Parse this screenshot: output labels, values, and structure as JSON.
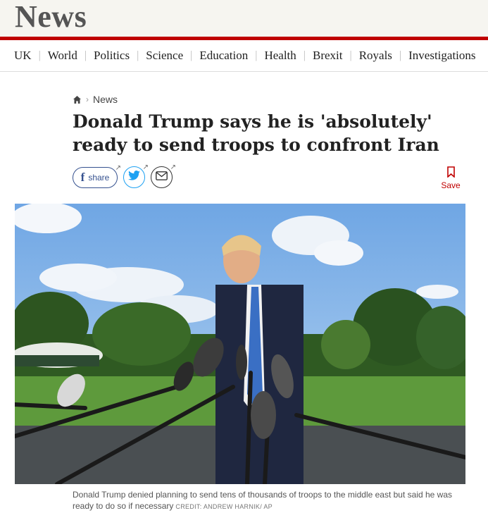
{
  "masthead": {
    "title": "News"
  },
  "nav": {
    "items": [
      "UK",
      "World",
      "Politics",
      "Science",
      "Education",
      "Health",
      "Brexit",
      "Royals",
      "Investigations"
    ]
  },
  "breadcrumb": {
    "section": "News"
  },
  "article": {
    "headline": "Donald Trump says he is 'absolutely' ready to send troops to confront Iran",
    "share_label": "share",
    "save_label": "Save",
    "caption": "Donald Trump denied planning to send tens of thousands of troops to the middle east but said he was ready to do so if necessary",
    "credit": "CREDIT:  ANDREW HARNIK/ AP"
  },
  "icons": {
    "home": "home-icon",
    "facebook": "facebook-icon",
    "twitter": "twitter-icon",
    "email": "email-icon",
    "bookmark": "bookmark-icon",
    "external": "external-arrow-icon"
  },
  "colors": {
    "brand_red": "#c00000",
    "masthead_bg": "#f6f5f0",
    "facebook_blue": "#35518f",
    "twitter_blue": "#1da1f2",
    "headline": "#222222"
  }
}
